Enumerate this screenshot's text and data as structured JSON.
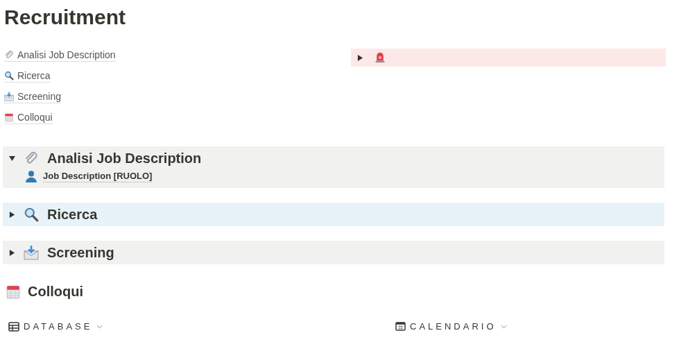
{
  "page": {
    "title": "Recruitment"
  },
  "links": [
    {
      "label": "Analisi Job Description"
    },
    {
      "label": "Ricerca"
    },
    {
      "label": "Screening"
    },
    {
      "label": "Colloqui"
    }
  ],
  "side_toggle": {
    "expanded": false,
    "color": "#fde8e8"
  },
  "sections": [
    {
      "heading": "Analisi Job Description",
      "expanded": true,
      "color": "#f1f1ef",
      "children": [
        {
          "label": "Job Description [RUOLO]"
        }
      ]
    },
    {
      "heading": "Ricerca",
      "expanded": false,
      "color": "#e7f3f8"
    },
    {
      "heading": "Screening",
      "expanded": false,
      "color": "#f1f1ef"
    }
  ],
  "colloqui": {
    "heading": "Colloqui"
  },
  "views": [
    {
      "label": "DATABASE"
    },
    {
      "label": "CALENDARIO"
    }
  ]
}
